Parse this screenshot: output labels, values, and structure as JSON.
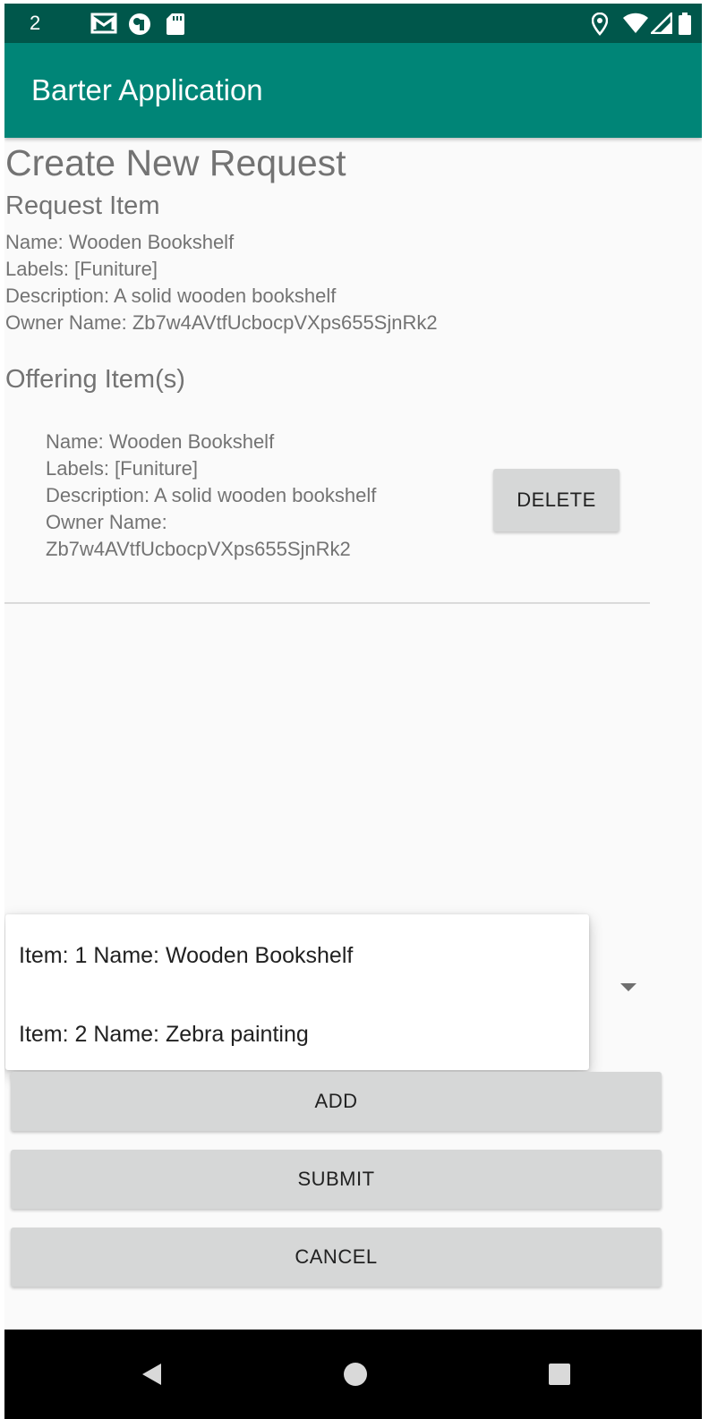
{
  "status_bar": {
    "time": "2",
    "notification_icons": [
      "gmail-icon",
      "vpn-key-icon",
      "sd-card-icon"
    ],
    "system_icons": [
      "location-icon",
      "wifi-icon",
      "cell-signal-icon",
      "battery-icon"
    ]
  },
  "app_bar": {
    "title": "Barter Application",
    "color": "#008577",
    "status_color": "#00574b"
  },
  "page": {
    "title": "Create New Request"
  },
  "request_item": {
    "heading": "Request Item",
    "name": "Name: Wooden Bookshelf",
    "labels": "Labels: [Funiture]",
    "description": "Description: A solid wooden bookshelf",
    "owner": "Owner Name: Zb7w4AVtfUcbocpVXps655SjnRk2"
  },
  "offering_items": {
    "heading": "Offering Item(s)",
    "items": [
      {
        "name": "Name: Wooden Bookshelf",
        "labels": "Labels: [Funiture]",
        "description": "Description: A solid wooden bookshelf",
        "owner_label": "Owner Name:",
        "owner_value": "Zb7w4AVtfUcbocpVXps655SjnRk2",
        "delete_label": "DELETE"
      }
    ]
  },
  "spinner": {
    "options": [
      "Item: 1 Name: Wooden Bookshelf",
      "Item: 2 Name: Zebra painting"
    ]
  },
  "actions": {
    "add_label": "ADD",
    "submit_label": "SUBMIT",
    "cancel_label": "CANCEL"
  },
  "nav_bar": {
    "buttons": [
      "back-icon",
      "home-icon",
      "recents-icon"
    ]
  }
}
